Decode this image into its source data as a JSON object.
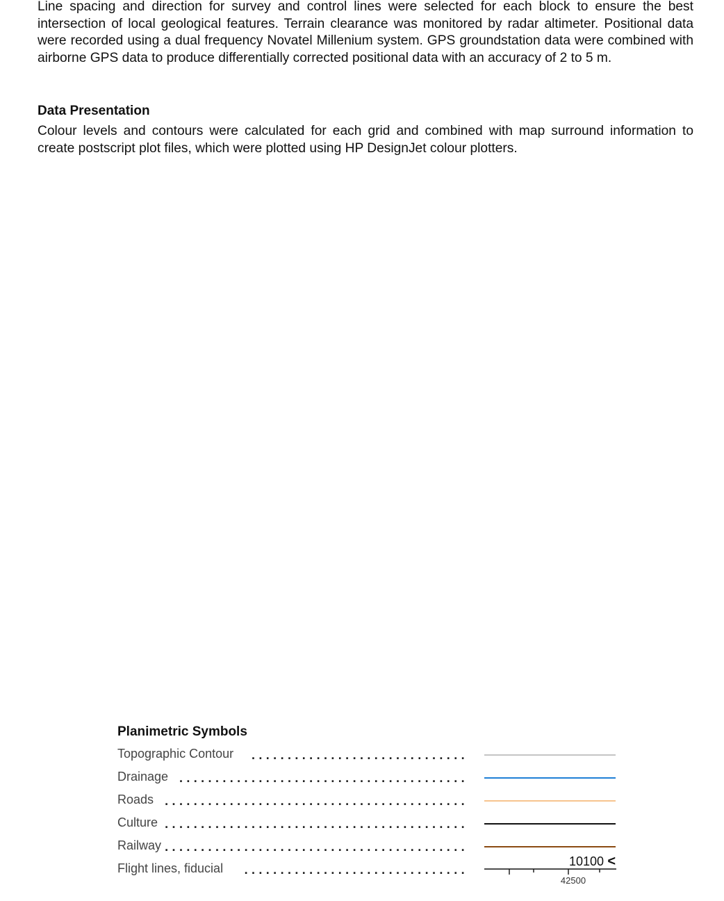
{
  "body": {
    "paragraph_1": "Line spacing and direction for survey and control lines were selected for each block to ensure the best intersection of local geological features. Terrain clearance was monitored by radar altimeter. Positional data were recorded using a dual frequency Novatel Millenium system. GPS groundstation data were combined with airborne GPS data to produce differentially corrected positional data with an accuracy of 2 to 5 m.",
    "heading_2": "Data Presentation",
    "paragraph_2": "Colour levels and contours were calculated for each grid and combined with map surround information to create postscript plot files, which were plotted using HP DesignJet colour plotters."
  },
  "legend": {
    "title": "Planimetric Symbols",
    "items": [
      {
        "label": "Topographic Contour",
        "color": "#c4c4c4"
      },
      {
        "label": "Drainage",
        "color": "#1f7fd6"
      },
      {
        "label": "Roads",
        "color": "#f7c48e"
      },
      {
        "label": "Culture",
        "color": "#111111"
      },
      {
        "label": "Railway",
        "color": "#8a4a12"
      }
    ],
    "flight_lines": {
      "label": "Flight lines, fiducial",
      "line_number": "10100",
      "direction_symbol": "<",
      "fiducial": "42500"
    }
  }
}
